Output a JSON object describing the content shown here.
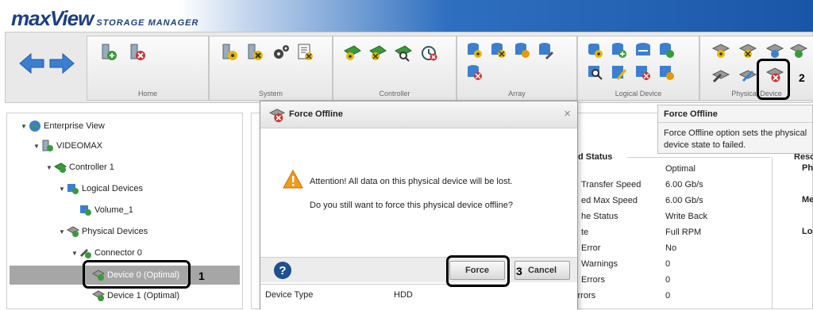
{
  "app": {
    "logo_main": "maxView",
    "logo_sub": "STORAGE MANAGER"
  },
  "toolbar": {
    "groups": [
      {
        "label": "Home"
      },
      {
        "label": "System"
      },
      {
        "label": "Controller"
      },
      {
        "label": "Array"
      },
      {
        "label": "Logical Device"
      },
      {
        "label": "Physical Device"
      }
    ]
  },
  "tree": {
    "nodes": [
      {
        "label": "Enterprise View"
      },
      {
        "label": "VIDEOMAX"
      },
      {
        "label": "Controller 1"
      },
      {
        "label": "Logical Devices"
      },
      {
        "label": "Volume_1"
      },
      {
        "label": "Physical Devices"
      },
      {
        "label": "Connector 0"
      },
      {
        "label": "Device 0 (Optimal)"
      },
      {
        "label": "Device 1 (Optimal)"
      }
    ]
  },
  "tooltip": {
    "title": "Force Offline",
    "body": "Force Offline option sets the physical device state to failed."
  },
  "dialog": {
    "title": "Force Offline",
    "close": "×",
    "warning": "Attention! All data on this physical device will be lost.",
    "question": "Do you still want to force this physical device offline?",
    "help": "?",
    "force_label": "Force",
    "cancel_label": "Cancel"
  },
  "content": {
    "status_header": "d Status",
    "status_rows": [
      {
        "k": "Transfer Speed",
        "v": "Optimal"
      },
      {
        "k": "Transfer Speed",
        "v": "6.00 Gb/s"
      },
      {
        "k": "ed Max Speed",
        "v": "6.00 Gb/s"
      },
      {
        "k": "he Status",
        "v": "Write Back"
      },
      {
        "k": "te",
        "v": "Full RPM"
      },
      {
        "k": "Error",
        "v": "No"
      },
      {
        "k": "Warnings",
        "v": "0"
      },
      {
        "k": "Errors",
        "v": "0"
      },
      {
        "k": "Medium Errors",
        "v": "0"
      }
    ],
    "left_rows": [
      {
        "k": "Device Type",
        "v": "HDD"
      }
    ],
    "side_labels": [
      "Reso",
      "Ph",
      "Me",
      "Lo"
    ]
  },
  "callouts": [
    "1",
    "2",
    "3"
  ],
  "colors": {
    "accent": "#1a56a8",
    "selected_row": "#a6a6a6"
  }
}
